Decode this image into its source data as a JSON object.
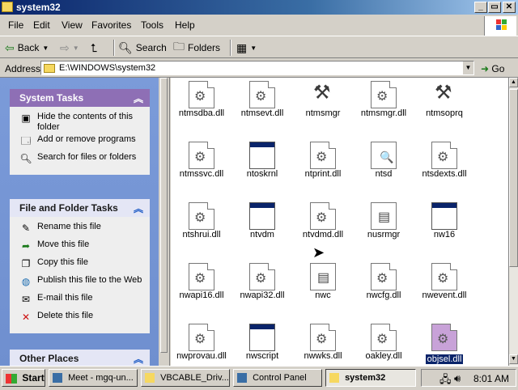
{
  "window": {
    "title": "system32",
    "buttons": {
      "minimize": "_",
      "maximize": "▭",
      "close": "✕"
    }
  },
  "menu": [
    "File",
    "Edit",
    "View",
    "Favorites",
    "Tools",
    "Help"
  ],
  "toolbar": {
    "back": "Back",
    "forward": "",
    "up": "",
    "search": "Search",
    "folders": "Folders",
    "views": ""
  },
  "address": {
    "label": "Address",
    "path": "E:\\WINDOWS\\system32",
    "go": "Go"
  },
  "task_pane": {
    "system_tasks": {
      "title": "System Tasks",
      "items": [
        {
          "label": "Hide the contents of this folder",
          "icon": "hide-icon"
        },
        {
          "label": "Add or remove programs",
          "icon": "programs-icon"
        },
        {
          "label": "Search for files or folders",
          "icon": "search-icon"
        }
      ]
    },
    "file_tasks": {
      "title": "File and Folder Tasks",
      "items": [
        {
          "label": "Rename this file",
          "icon": "rename-icon"
        },
        {
          "label": "Move this file",
          "icon": "move-icon"
        },
        {
          "label": "Copy this file",
          "icon": "copy-icon"
        },
        {
          "label": "Publish this file to the Web",
          "icon": "publish-icon"
        },
        {
          "label": "E-mail this file",
          "icon": "email-icon"
        },
        {
          "label": "Delete this file",
          "icon": "delete-icon"
        }
      ]
    },
    "other_places": {
      "title": "Other Places"
    }
  },
  "files": [
    {
      "name": "ntmsdba.dll",
      "type": "dll"
    },
    {
      "name": "ntmsevt.dll",
      "type": "dll"
    },
    {
      "name": "ntmsmgr",
      "type": "tool"
    },
    {
      "name": "ntmsmgr.dll",
      "type": "dll"
    },
    {
      "name": "ntmsoprq",
      "type": "tool"
    },
    {
      "name": "ntmssvc.dll",
      "type": "dll"
    },
    {
      "name": "ntoskrnl",
      "type": "exe"
    },
    {
      "name": "ntprint.dll",
      "type": "dll"
    },
    {
      "name": "ntsd",
      "type": "nts"
    },
    {
      "name": "ntsdexts.dll",
      "type": "dll"
    },
    {
      "name": "ntshrui.dll",
      "type": "dll"
    },
    {
      "name": "ntvdm",
      "type": "exe"
    },
    {
      "name": "ntvdmd.dll",
      "type": "dll"
    },
    {
      "name": "nusrmgr",
      "type": "sys"
    },
    {
      "name": "nw16",
      "type": "exe"
    },
    {
      "name": "nwapi16.dll",
      "type": "dll"
    },
    {
      "name": "nwapi32.dll",
      "type": "dll"
    },
    {
      "name": "nwc",
      "type": "sys"
    },
    {
      "name": "nwcfg.dll",
      "type": "dll"
    },
    {
      "name": "nwevent.dll",
      "type": "dll"
    },
    {
      "name": "nwprovau.dll",
      "type": "dll"
    },
    {
      "name": "nwscript",
      "type": "exe"
    },
    {
      "name": "nwwks.dll",
      "type": "dll"
    },
    {
      "name": "oakley.dll",
      "type": "dll"
    },
    {
      "name": "objsel.dll",
      "type": "dll",
      "selected": true
    }
  ],
  "taskbar": {
    "start": "Start",
    "tasks": [
      {
        "label": "Meet - mgq-un...",
        "active": false
      },
      {
        "label": "VBCABLE_Driv...",
        "active": false
      },
      {
        "label": "Control Panel",
        "active": false
      },
      {
        "label": "system32",
        "active": true
      }
    ],
    "clock": "8:01 AM"
  }
}
